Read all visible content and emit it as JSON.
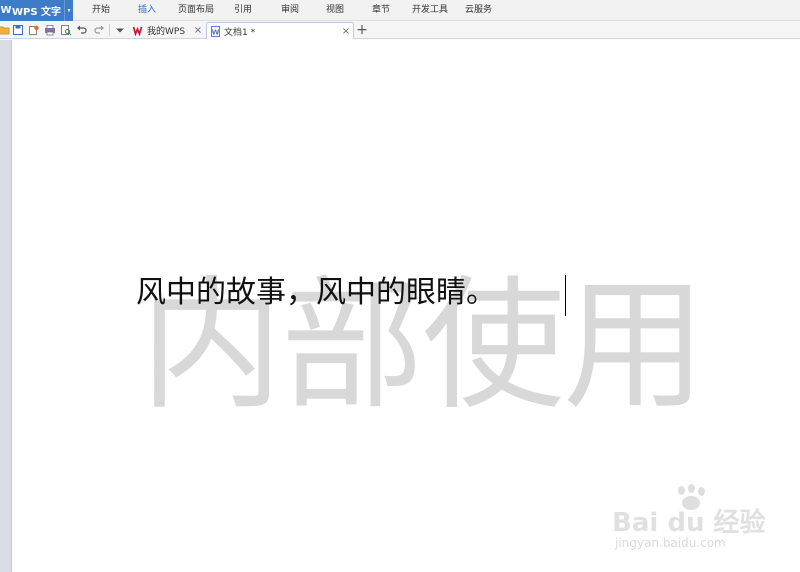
{
  "app": {
    "logo": "W",
    "title": "WPS 文字",
    "caret": "▾"
  },
  "menu": {
    "items": [
      "开始",
      "插入",
      "页面布局",
      "引用",
      "审阅",
      "视图",
      "章节",
      "开发工具",
      "云服务"
    ],
    "active": "插入"
  },
  "toolbar": {
    "icons": [
      "open-folder-icon",
      "save-icon",
      "save-as-icon",
      "print-icon",
      "print-preview-icon",
      "undo-icon",
      "redo-icon",
      "dropdown-icon"
    ]
  },
  "tabs": [
    {
      "label": "我的WPS",
      "icon": "wps-logo-icon",
      "close": "×",
      "active": false
    },
    {
      "label": "文档1 *",
      "icon": "document-icon",
      "close": "×",
      "active": true
    }
  ],
  "new_tab": "+",
  "document": {
    "text": "风中的故事，风中的眼睛。",
    "watermark": "内部使用"
  },
  "badge": {
    "brand": "Bai du 经验",
    "url": "jingyan.baidu.com"
  },
  "colors": {
    "accent": "#3d7cc9",
    "menu_active": "#2f6fbf",
    "watermark": "#d8d8d8",
    "wps_red": "#c8102e"
  }
}
